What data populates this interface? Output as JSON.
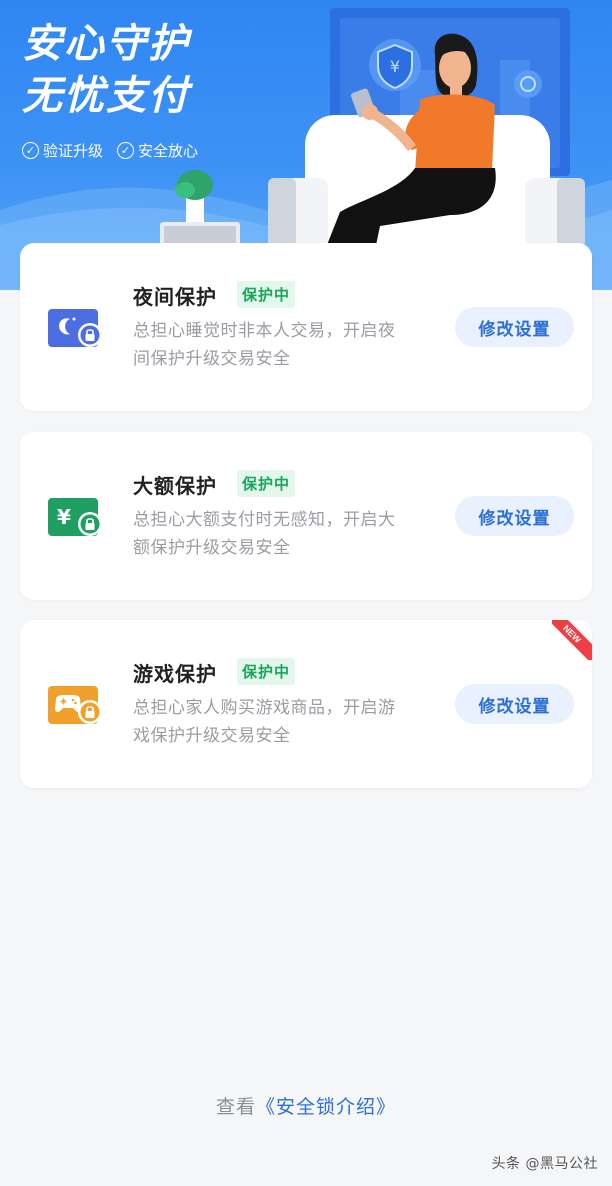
{
  "banner": {
    "title_line1": "安心守护",
    "title_line2": "无忧支付",
    "badges": [
      "验证升级",
      "安全放心"
    ]
  },
  "cards": [
    {
      "title": "夜间保护",
      "status": "保护中",
      "desc_line1": "总担心睡觉时非本人交易，开启夜",
      "desc_line2": "间保护升级交易安全",
      "button": "修改设置",
      "icon": "moon-lock-icon",
      "icon_color": "#4d6de3"
    },
    {
      "title": "大额保护",
      "status": "保护中",
      "desc_line1": "总担心大额支付时无感知，开启大",
      "desc_line2": "额保护升级交易安全",
      "button": "修改设置",
      "icon": "yuan-lock-icon",
      "icon_color": "#1f9f62"
    },
    {
      "title": "游戏保护",
      "status": "保护中",
      "desc_line1": "总担心家人购买游戏商品，开启游",
      "desc_line2": "戏保护升级交易安全",
      "button": "修改设置",
      "icon": "gamepad-lock-icon",
      "icon_color": "#f0a12c",
      "ribbon": "NEW"
    }
  ],
  "footer": {
    "prefix": "查看",
    "link": "《安全锁介绍》"
  },
  "watermark": "头条 @黑马公社",
  "colors": {
    "brand_blue": "#2f86f3",
    "status_green": "#1aa55b",
    "link_blue": "#2e6fd6",
    "ribbon_red": "#ef3e45"
  }
}
